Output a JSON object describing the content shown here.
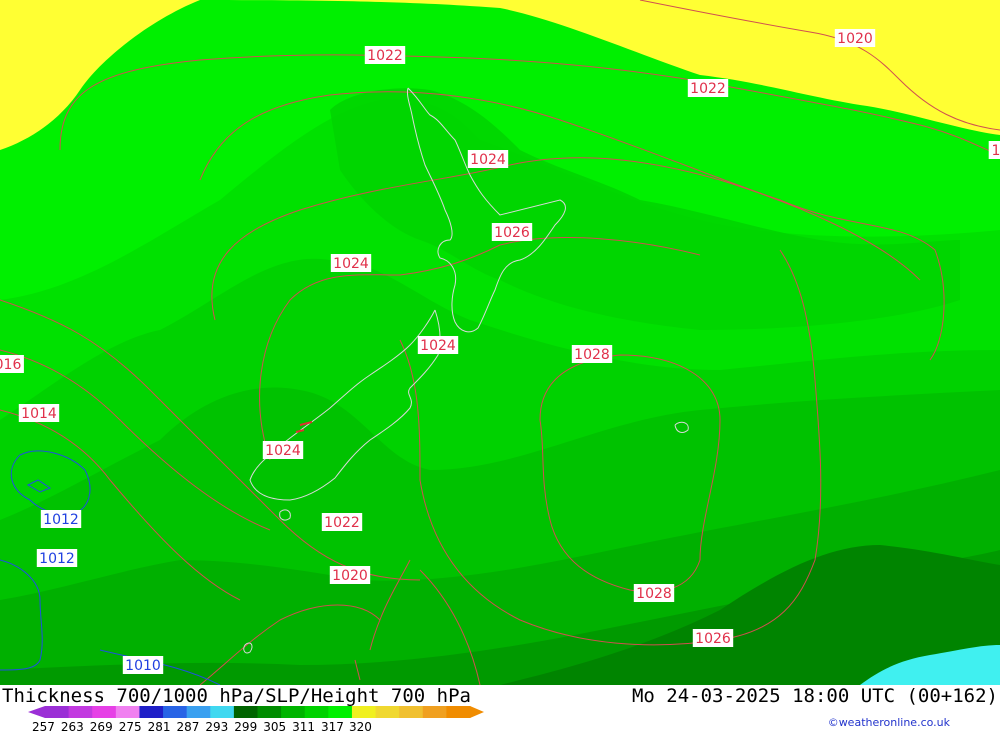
{
  "title": "Thickness 700/1000 hPa/SLP/Height 700 hPa",
  "datetime": "Mo 24-03-2025 18:00 UTC (00+162)",
  "credit": "©weatheronline.co.uk",
  "legend": {
    "ticks": [
      "257",
      "263",
      "269",
      "275",
      "281",
      "287",
      "293",
      "299",
      "305",
      "311",
      "317",
      "320"
    ],
    "colors": [
      "#9b2fd6",
      "#c23ae0",
      "#e640e6",
      "#f080f0",
      "#2020c8",
      "#2864e6",
      "#3aa0f0",
      "#40d8f0",
      "#006400",
      "#008c00",
      "#00b400",
      "#00d200",
      "#00f000",
      "#f0f020",
      "#f0d830",
      "#f0c030",
      "#f0a020",
      "#f08c00"
    ]
  },
  "isobar_labels": [
    {
      "text": "1022",
      "color": "#e0304a"
    },
    {
      "text": "1020",
      "color": "#e0304a"
    },
    {
      "text": "1022",
      "color": "#e0304a"
    },
    {
      "text": "1024",
      "color": "#e0304a"
    },
    {
      "text": "1026",
      "color": "#e0304a"
    },
    {
      "text": "1024",
      "color": "#e0304a"
    },
    {
      "text": "1024",
      "color": "#e0304a"
    },
    {
      "text": "1028",
      "color": "#e0304a"
    },
    {
      "text": "1014",
      "color": "#e0304a"
    },
    {
      "text": "016",
      "color": "#e0304a"
    },
    {
      "text": "1024",
      "color": "#e0304a"
    },
    {
      "text": "1022",
      "color": "#e0304a"
    },
    {
      "text": "1020",
      "color": "#e0304a"
    },
    {
      "text": "1028",
      "color": "#e0304a"
    },
    {
      "text": "1026",
      "color": "#e0304a"
    },
    {
      "text": "1012",
      "color": "#2040e0"
    },
    {
      "text": "1012",
      "color": "#2040e0"
    },
    {
      "text": "1010",
      "color": "#2040e0"
    },
    {
      "text": "1",
      "color": "#e0304a"
    }
  ]
}
